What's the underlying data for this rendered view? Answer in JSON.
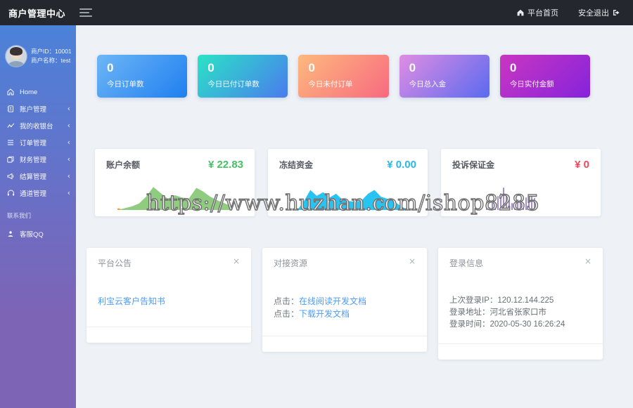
{
  "header": {
    "title": "商户管理中心",
    "home_link": "平台首页",
    "logout_link": "安全退出"
  },
  "user": {
    "id_label": "商户ID：",
    "id_value": "10001",
    "name_label": "商户名称：",
    "name_value": "test"
  },
  "menu": {
    "items": [
      {
        "label": "Home",
        "icon": "home-icon",
        "has_children": false
      },
      {
        "label": "账户管理",
        "icon": "address-book-icon",
        "has_children": true
      },
      {
        "label": "我的收银台",
        "icon": "chart-line-icon",
        "has_children": true
      },
      {
        "label": "订单管理",
        "icon": "list-icon",
        "has_children": true
      },
      {
        "label": "财务管理",
        "icon": "copy-icon",
        "has_children": true
      },
      {
        "label": "结算管理",
        "icon": "bullhorn-icon",
        "has_children": true
      },
      {
        "label": "通道管理",
        "icon": "headset-icon",
        "has_children": true
      }
    ],
    "section_label": "联系我们",
    "qq_label": "客服QQ"
  },
  "icons": {
    "chevron": "‹",
    "close": "×"
  },
  "stats": [
    {
      "value": "0",
      "label": "今日订单数",
      "gradient_from": "#6eb6f6",
      "gradient_to": "#1f7ff0"
    },
    {
      "value": "0",
      "label": "今日已付订单数",
      "gradient_from": "#2be3c6",
      "gradient_to": "#4a7bee"
    },
    {
      "value": "0",
      "label": "今日未付订单",
      "gradient_from": "#fdb97d",
      "gradient_to": "#f86a80"
    },
    {
      "value": "0",
      "label": "今日总入金",
      "gradient_from": "#e08de2",
      "gradient_to": "#5a6af0"
    },
    {
      "value": "0",
      "label": "今日实付金额",
      "gradient_from": "#ca36c1",
      "gradient_to": "#8523dc"
    }
  ],
  "finance": [
    {
      "title": "账户余额",
      "value": "¥ 22.83",
      "value_color": "#45c264"
    },
    {
      "title": "冻结资金",
      "value": "¥ 0.00",
      "value_color": "#28b8f0"
    },
    {
      "title": "投诉保证金",
      "value": "¥ 0",
      "value_color": "#f4455a"
    }
  ],
  "chart_data": [
    {
      "type": "area",
      "title": "账户余额",
      "color": "#90cc80",
      "marker_color": "#f5a623",
      "series": [
        {
          "name": "账户余额",
          "values": [
            0,
            6,
            12,
            22,
            45,
            78,
            58,
            38,
            50,
            42,
            40,
            75,
            62,
            44,
            32,
            22,
            12
          ]
        }
      ]
    },
    {
      "type": "area",
      "title": "冻结资金",
      "color": "#29c3f2",
      "series": [
        {
          "name": "冻结资金",
          "values": [
            0,
            30,
            68,
            48,
            60,
            42,
            55,
            35,
            30,
            28,
            32,
            55,
            68,
            45,
            38,
            30,
            15,
            2
          ]
        }
      ]
    },
    {
      "type": "bar",
      "title": "投诉保证金",
      "color": "#a48bd8",
      "series": [
        {
          "name": "投诉保证金",
          "values": [
            38,
            12,
            28,
            16,
            60,
            72,
            95,
            65,
            48,
            28,
            18,
            45,
            33,
            28,
            52,
            58,
            58,
            50
          ]
        }
      ]
    }
  ],
  "announce_card": {
    "title": "平台公告",
    "link": "利宝云客户告知书"
  },
  "resource_card": {
    "title": "对接资源",
    "rows": [
      {
        "prefix": "点击：",
        "link": "在线阅读开发文档"
      },
      {
        "prefix": "点击：",
        "link": "下载开发文档"
      }
    ]
  },
  "login_card": {
    "title": "登录信息",
    "lines": [
      "上次登录IP：120.12.144.225",
      "登录地址：河北省张家口市",
      "登录时间：2020-05-30 16:26:24"
    ]
  },
  "watermark": "https://www.huzhan.com/ishop8285"
}
